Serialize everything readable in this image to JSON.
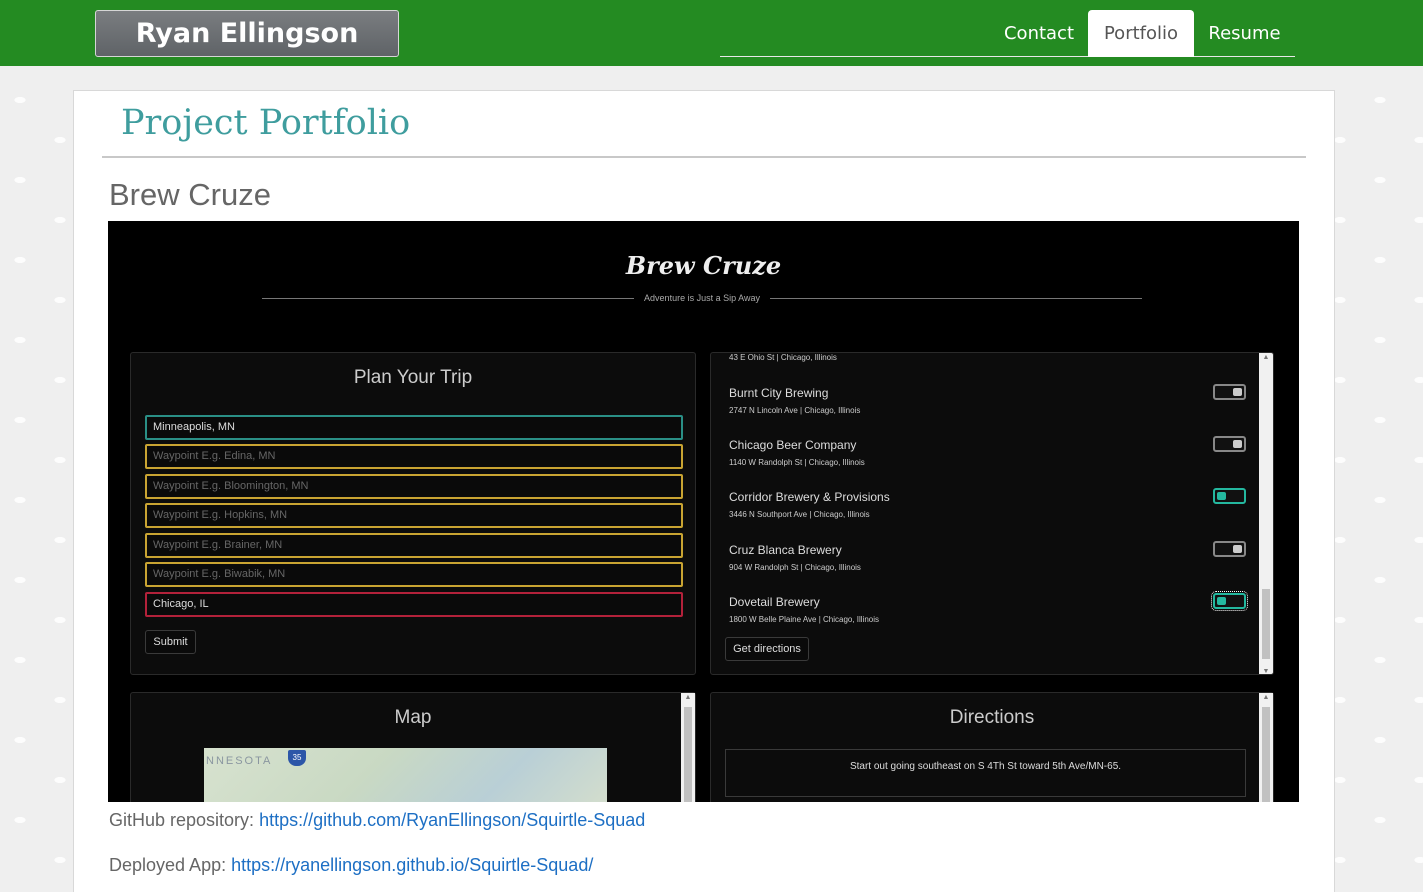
{
  "header": {
    "brand": "Ryan Ellingson",
    "nav": [
      "Contact",
      "Portfolio",
      "Resume"
    ],
    "active_nav": "Portfolio"
  },
  "page": {
    "title": "Project Portfolio",
    "project_name": "Brew Cruze",
    "github_label": "GitHub repository:",
    "github_url": "https://github.com/RyanEllingson/Squirtle-Squad",
    "deployed_label": "Deployed App:",
    "deployed_url": "https://ryanellingson.github.io/Squirtle-Squad/"
  },
  "screenshot": {
    "app_title": "Brew Cruze",
    "tagline": "Adventure is Just a Sip Away",
    "plan": {
      "title": "Plan Your Trip",
      "start_value": "Minneapolis, MN",
      "waypoints": [
        "Waypoint E.g. Edina, MN",
        "Waypoint E.g. Bloomington, MN",
        "Waypoint E.g. Hopkins, MN",
        "Waypoint E.g. Brainer, MN",
        "Waypoint E.g. Biwabik, MN"
      ],
      "end_value": "Chicago, IL",
      "submit": "Submit"
    },
    "breweries": {
      "top_address": "43 E Ohio St | Chicago, Illinois",
      "items": [
        {
          "name": "Burnt City Brewing",
          "address": "2747 N Lincoln Ave | Chicago, Illinois",
          "selected": false
        },
        {
          "name": "Chicago Beer Company",
          "address": "1140 W Randolph St | Chicago, Illinois",
          "selected": false
        },
        {
          "name": "Corridor Brewery & Provisions",
          "address": "3446 N Southport Ave | Chicago, Illinois",
          "selected": true
        },
        {
          "name": "Cruz Blanca Brewery",
          "address": "904 W Randolph St | Chicago, Illinois",
          "selected": false
        },
        {
          "name": "Dovetail Brewery",
          "address": "1800 W Belle Plaine Ave | Chicago, Illinois",
          "selected": true
        }
      ],
      "get_directions": "Get directions"
    },
    "map": {
      "title": "Map",
      "label": "NNESOTA",
      "shield": "35"
    },
    "directions": {
      "title": "Directions",
      "step": "Start out going southeast on S 4Th St toward 5th Ave/MN-65."
    },
    "colors": {
      "start_border": "#2a8f86",
      "waypoint_border": "#c9a432",
      "end_border": "#b3213a",
      "toggle_on": "#24b89f"
    }
  },
  "colors": {
    "navbar": "#248b22",
    "title": "#3f9d9e",
    "link": "#1d6fc4"
  }
}
